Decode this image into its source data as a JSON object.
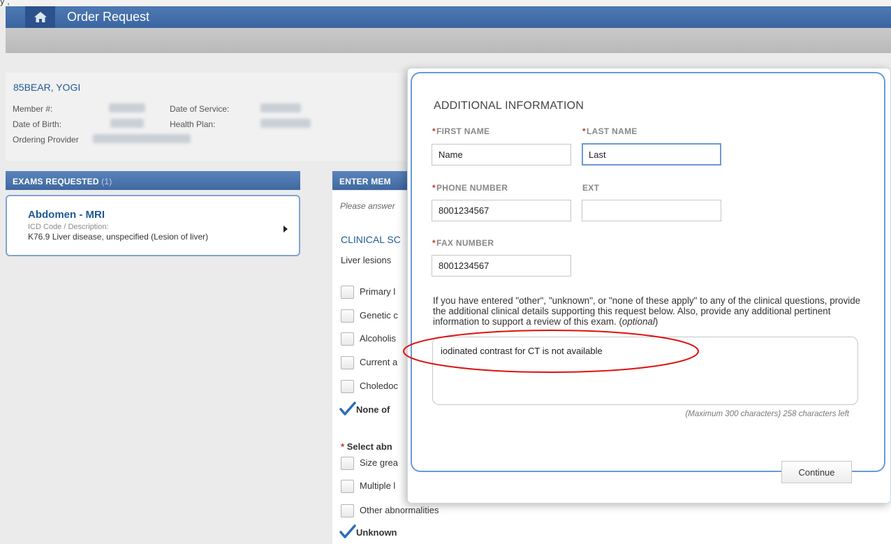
{
  "app": {
    "title": "Order Request",
    "top_partial_text": "y       ,"
  },
  "icons": {
    "home": "home-icon",
    "arrow": "chevron-right-icon",
    "check": "checkmark-icon"
  },
  "colors": {
    "brand_blue": "#3f689f",
    "link_blue": "#1f5a96",
    "required_red": "#c0392b",
    "annotation_red": "#e01010"
  },
  "patient": {
    "name": "85BEAR, YOGI",
    "member_label": "Member #:",
    "dob_label": "Date of Birth:",
    "provider_label": "Ordering Provider",
    "service_label": "Date of Service:",
    "plan_label": "Health Plan:"
  },
  "exams": {
    "header": "EXAMS REQUESTED",
    "count": "(1)",
    "items": [
      {
        "title": "Abdomen - MRI",
        "code_label": "ICD Code / Description:",
        "description": "K76.9 Liver disease, unspecified (Lesion of liver)"
      }
    ]
  },
  "member_panel": {
    "header": "ENTER MEM",
    "instruction": "Please answer",
    "clinical_header": "CLINICAL SC",
    "question": "Liver lesions",
    "options_a": [
      {
        "label": "Primary l",
        "checked": false
      },
      {
        "label": "Genetic c",
        "checked": false
      },
      {
        "label": "Alcoholis",
        "checked": false
      },
      {
        "label": "Current a",
        "checked": false
      },
      {
        "label": "Choledoc",
        "checked": false
      },
      {
        "label": "None of",
        "checked": true
      }
    ],
    "select_label": "Select abn",
    "options_b": [
      {
        "label": "Size grea",
        "checked": false
      },
      {
        "label": "Multiple l",
        "checked": false
      },
      {
        "label": "Other abnormalities",
        "checked": false
      },
      {
        "label": "Unknown",
        "checked": true
      }
    ]
  },
  "modal": {
    "title": "ADDITIONAL INFORMATION",
    "first_name_label": "FIRST NAME",
    "first_name_value": "Name",
    "last_name_label": "LAST NAME",
    "last_name_value": "Last",
    "phone_label": "PHONE NUMBER",
    "phone_value": "8001234567",
    "ext_label": "EXT",
    "ext_value": "",
    "fax_label": "FAX NUMBER",
    "fax_value": "8001234567",
    "info_text_1": "If you have entered \"other\", \"unknown\", or \"none of these apply\" to any of the clinical questions, provide the additional clinical details supporting this request below. Also, provide any additional pertinent information to support a review of this exam. (",
    "info_optional": "optional",
    "info_text_2": ")",
    "notes_value": "iodinated contrast for CT is not available",
    "char_count": "(Maximum 300 characters) 258 characters left",
    "continue_label": "Continue"
  }
}
